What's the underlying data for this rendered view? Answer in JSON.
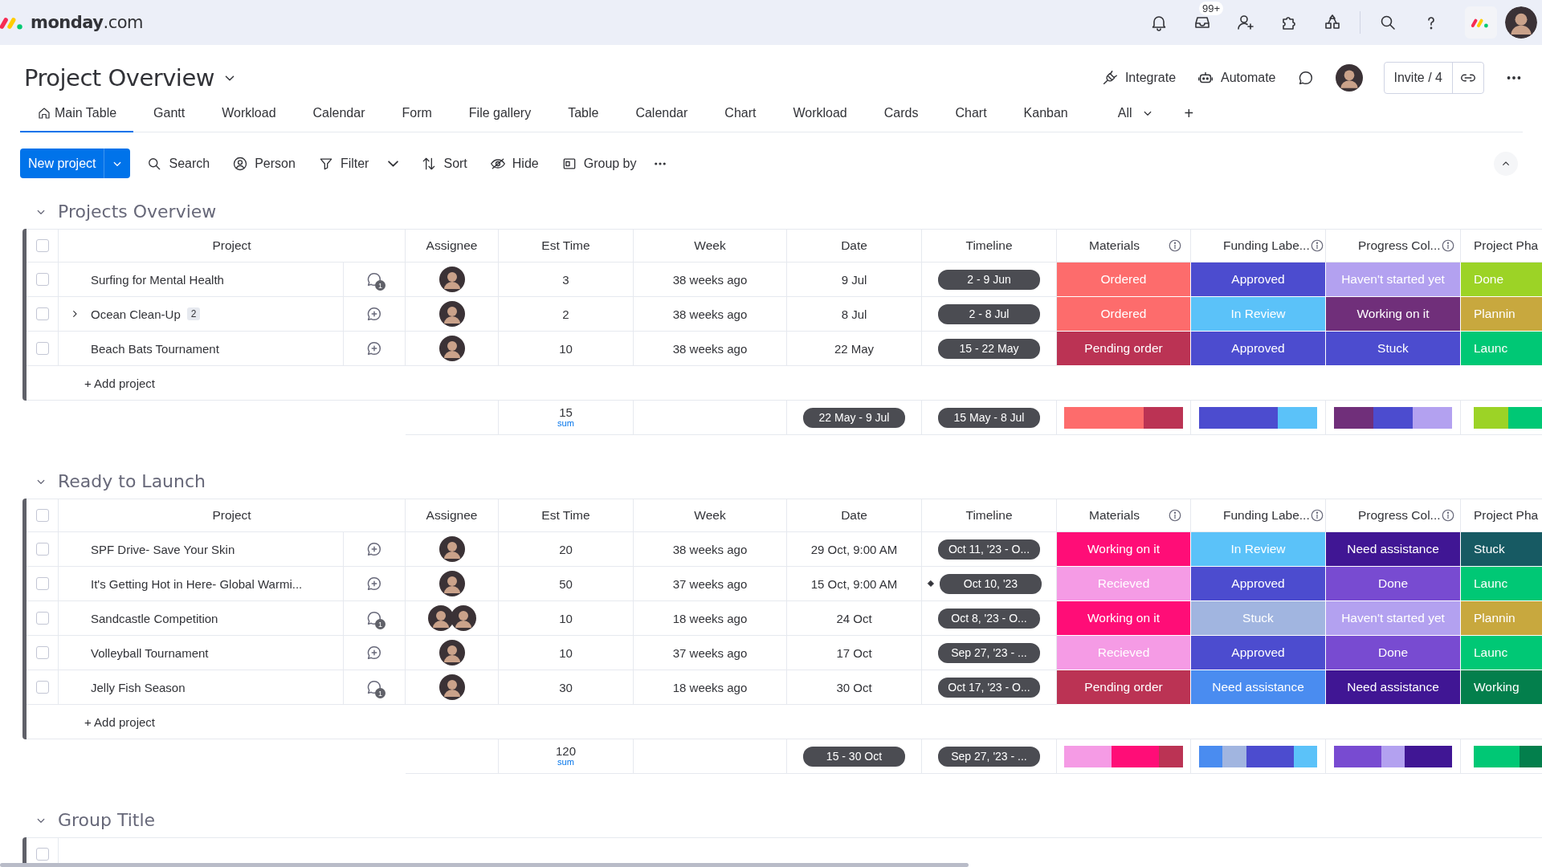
{
  "app": {
    "logo_text": "**monday**.com",
    "inbox_badge": "99+"
  },
  "board": {
    "title": "Project Overview",
    "actions": [
      {
        "kind": "integrate",
        "label": "Integrate"
      },
      {
        "kind": "automate",
        "label": "Automate"
      }
    ],
    "invite_label": "Invite / 4"
  },
  "tabs": [
    {
      "label": "Main Table",
      "selected": true,
      "kind": "home"
    },
    {
      "label": "Gantt",
      "selected": false,
      "kind": "view"
    },
    {
      "label": "Workload",
      "selected": false,
      "kind": "view"
    },
    {
      "label": "Calendar",
      "selected": false,
      "kind": "view"
    },
    {
      "label": "Form",
      "selected": false,
      "kind": "view"
    },
    {
      "label": "File gallery",
      "selected": false,
      "kind": "view"
    },
    {
      "label": "Table",
      "selected": false,
      "kind": "view"
    },
    {
      "label": "Calendar",
      "selected": false,
      "kind": "view"
    },
    {
      "label": "Chart",
      "selected": false,
      "kind": "view"
    },
    {
      "label": "Workload",
      "selected": false,
      "kind": "view"
    },
    {
      "label": "Cards",
      "selected": false,
      "kind": "view"
    },
    {
      "label": "Chart",
      "selected": false,
      "kind": "view"
    },
    {
      "label": "Kanban",
      "selected": false,
      "kind": "view"
    }
  ],
  "tabs_more": {
    "label": "All"
  },
  "add_tab": "+",
  "toolbar": {
    "new_button": "New project",
    "tools": [
      {
        "kind": "search",
        "label": "Search",
        "dropdown": false
      },
      {
        "kind": "person",
        "label": "Person",
        "dropdown": false
      },
      {
        "kind": "filter",
        "label": "Filter",
        "dropdown": true
      },
      {
        "kind": "sort",
        "label": "Sort",
        "dropdown": false
      },
      {
        "kind": "hide",
        "label": "Hide",
        "dropdown": false
      },
      {
        "kind": "group",
        "label": "Group by",
        "dropdown": false
      }
    ]
  },
  "groups": [
    {
      "title": "Projects Overview",
      "expanded": true,
      "all_selected": false,
      "columns": [
        {
          "label": "Project",
          "info": false
        },
        {
          "label": "Assignee",
          "info": false
        },
        {
          "label": "Est Time",
          "info": false
        },
        {
          "label": "Week",
          "info": false
        },
        {
          "label": "Date",
          "info": false
        },
        {
          "label": "Timeline",
          "info": false
        },
        {
          "label": "Materials",
          "info": true
        },
        {
          "label": "Funding Labe...",
          "info": true
        },
        {
          "label": "Progress Col...",
          "info": true
        },
        {
          "label": "Project Pha",
          "info": false
        }
      ],
      "rows": [
        {
          "checked": false,
          "name": "Surfing for Mental Health",
          "updates": "1",
          "assignees": [
            {
              "kind": "avatar"
            }
          ],
          "est_time": "3",
          "week": "38 weeks ago",
          "date": "9 Jul",
          "timeline": "2 - 9 Jun",
          "milestone": false,
          "materials": {
            "label": "Ordered",
            "color": "#fd6c6c"
          },
          "funding": {
            "label": "Approved",
            "color": "#4c4ccf"
          },
          "progress": {
            "label": "Haven't started yet",
            "color": "#b3a1f0"
          },
          "phase": {
            "label": "Done",
            "color": "#9cd326"
          }
        },
        {
          "checked": false,
          "name": "Ocean Clean-Up",
          "subitems": "2",
          "assignees": [
            {
              "kind": "avatar"
            }
          ],
          "est_time": "2",
          "week": "38 weeks ago",
          "date": "8 Jul",
          "timeline": "2 - 8 Jul",
          "milestone": false,
          "materials": {
            "label": "Ordered",
            "color": "#fd6c6c"
          },
          "funding": {
            "label": "In Review",
            "color": "#5bc2f9"
          },
          "progress": {
            "label": "Working on it",
            "color": "#702f7a"
          },
          "phase": {
            "label": "Plannin",
            "color": "#c8a83e"
          }
        },
        {
          "checked": false,
          "name": "Beach Bats Tournament",
          "assignees": [
            {
              "kind": "avatar"
            }
          ],
          "est_time": "10",
          "week": "38 weeks ago",
          "date": "22 May",
          "timeline": "15 - 22 May",
          "milestone": false,
          "materials": {
            "label": "Pending order",
            "color": "#bb3354"
          },
          "funding": {
            "label": "Approved",
            "color": "#4c4ccf"
          },
          "progress": {
            "label": "Stuck",
            "color": "#4c4ccf"
          },
          "phase": {
            "label": "Launc",
            "color": "#00c875"
          }
        }
      ],
      "add_label": "+ Add project",
      "summary": {
        "est_time": "15",
        "est_label": "sum",
        "date": "22 May - 9 Jul",
        "timeline": "15 May - 8 Jul",
        "materials": [
          {
            "color": "#fd6c6c"
          },
          {
            "color": "#fd6c6c"
          },
          {
            "color": "#bb3354"
          }
        ],
        "funding": [
          {
            "color": "#4c4ccf"
          },
          {
            "color": "#4c4ccf"
          },
          {
            "color": "#5bc2f9"
          }
        ],
        "progress": [
          {
            "color": "#702f7a"
          },
          {
            "color": "#4c4ccf"
          },
          {
            "color": "#b3a1f0"
          }
        ],
        "phase": [
          {
            "color": "#9cd326"
          },
          {
            "color": "#00c875"
          }
        ]
      }
    },
    {
      "title": "Ready to Launch",
      "expanded": true,
      "all_selected": false,
      "columns": [
        {
          "label": "Project",
          "info": false
        },
        {
          "label": "Assignee",
          "info": false
        },
        {
          "label": "Est Time",
          "info": false
        },
        {
          "label": "Week",
          "info": false
        },
        {
          "label": "Date",
          "info": false
        },
        {
          "label": "Timeline",
          "info": false
        },
        {
          "label": "Materials",
          "info": true
        },
        {
          "label": "Funding Labe...",
          "info": true
        },
        {
          "label": "Progress Col...",
          "info": true
        },
        {
          "label": "Project Pha",
          "info": false
        }
      ],
      "rows": [
        {
          "checked": false,
          "name": "SPF Drive- Save Your Skin",
          "assignees": [
            {
              "kind": "avatar"
            }
          ],
          "est_time": "20",
          "week": "38 weeks ago",
          "date": "29 Oct, 9:00 AM",
          "timeline": "Oct 11, '23 - O...",
          "milestone": false,
          "materials": {
            "label": "Working on it",
            "color": "#ff0d77"
          },
          "funding": {
            "label": "In Review",
            "color": "#5bc2f9"
          },
          "progress": {
            "label": "Need assistance",
            "color": "#401694"
          },
          "phase": {
            "label": "Stuck",
            "color": "#175a63"
          }
        },
        {
          "checked": false,
          "name": "It's Getting Hot in Here- Global Warmi...",
          "assignees": [
            {
              "kind": "avatar"
            }
          ],
          "est_time": "50",
          "week": "37 weeks ago",
          "date": "15 Oct, 9:00 AM",
          "timeline": "Oct 10, '23",
          "milestone": true,
          "materials": {
            "label": "Recieved",
            "color": "#f59be5"
          },
          "funding": {
            "label": "Approved",
            "color": "#4c4ccf"
          },
          "progress": {
            "label": "Done",
            "color": "#784bd1"
          },
          "phase": {
            "label": "Launc",
            "color": "#00c875"
          }
        },
        {
          "checked": false,
          "name": "Sandcastle Competition",
          "updates": "1",
          "assignees": [
            {
              "kind": "avatar"
            },
            {
              "kind": "avatar"
            }
          ],
          "est_time": "10",
          "week": "18 weeks ago",
          "date": "24 Oct",
          "timeline": "Oct 8, '23 - O...",
          "milestone": false,
          "materials": {
            "label": "Working on it",
            "color": "#ff0d77"
          },
          "funding": {
            "label": "Stuck",
            "color": "#a1b5e0"
          },
          "progress": {
            "label": "Haven't started yet",
            "color": "#b3a1f0"
          },
          "phase": {
            "label": "Plannin",
            "color": "#c8a83e"
          }
        },
        {
          "checked": false,
          "name": "Volleyball Tournament",
          "assignees": [
            {
              "kind": "avatar"
            }
          ],
          "est_time": "10",
          "week": "37 weeks ago",
          "date": "17 Oct",
          "timeline": "Sep 27, '23 - ...",
          "milestone": false,
          "materials": {
            "label": "Recieved",
            "color": "#f59be5"
          },
          "funding": {
            "label": "Approved",
            "color": "#4c4ccf"
          },
          "progress": {
            "label": "Done",
            "color": "#784bd1"
          },
          "phase": {
            "label": "Launc",
            "color": "#00c875"
          }
        },
        {
          "checked": false,
          "name": "Jelly Fish Season",
          "updates": "1",
          "assignees": [
            {
              "kind": "avatar"
            }
          ],
          "est_time": "30",
          "week": "18 weeks ago",
          "date": "30 Oct",
          "timeline": "Oct 17, '23 - O...",
          "milestone": false,
          "materials": {
            "label": "Pending order",
            "color": "#bb3354"
          },
          "funding": {
            "label": "Need assistance",
            "color": "#4a8cf0"
          },
          "progress": {
            "label": "Need assistance",
            "color": "#401694"
          },
          "phase": {
            "label": "Working",
            "color": "#037f4c"
          }
        }
      ],
      "add_label": "+ Add project",
      "summary": {
        "est_time": "120",
        "est_label": "sum",
        "date": "15 - 30 Oct",
        "timeline": "Sep 27, '23 - ...",
        "materials": [
          {
            "color": "#f59be5"
          },
          {
            "color": "#f59be5"
          },
          {
            "color": "#ff0d77"
          },
          {
            "color": "#ff0d77"
          },
          {
            "color": "#bb3354"
          }
        ],
        "funding": [
          {
            "color": "#4a8cf0"
          },
          {
            "color": "#a1b5e0"
          },
          {
            "color": "#4c4ccf"
          },
          {
            "color": "#4c4ccf"
          },
          {
            "color": "#5bc2f9"
          }
        ],
        "progress": [
          {
            "color": "#784bd1"
          },
          {
            "color": "#784bd1"
          },
          {
            "color": "#b3a1f0"
          },
          {
            "color": "#401694"
          },
          {
            "color": "#401694"
          }
        ],
        "phase": [
          {
            "color": "#00c875"
          },
          {
            "color": "#00c875"
          },
          {
            "color": "#037f4c"
          }
        ]
      }
    },
    {
      "title": "Group Title",
      "expanded": true,
      "all_selected": false
    }
  ]
}
